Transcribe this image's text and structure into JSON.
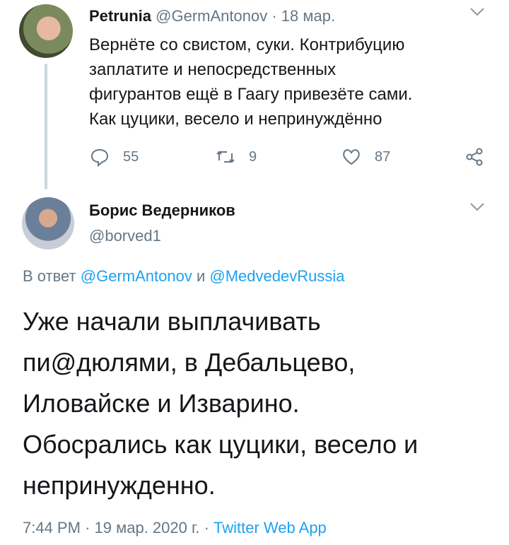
{
  "parent": {
    "author_name": "Petrunia",
    "handle": "@GermAntonov",
    "separator": "·",
    "date": "18 мар.",
    "text_lines": [
      "Вернёте со свистом, суки. Контрибуцию",
      "заплатите и непосредственных",
      "фигурантов ещё в Гаагу привезёте сами.",
      "Как цуцики, весело и непринуждённо"
    ],
    "replies": "55",
    "retweets": "9",
    "likes": "87",
    "icons": [
      "reply-icon",
      "retweet-icon",
      "like-icon",
      "share-icon",
      "chevron-down-icon"
    ]
  },
  "reply": {
    "author_name": "Борис Ведерников",
    "handle": "@borved1",
    "reply_prefix": "В ответ",
    "reply_to_1": "@GermAntonov",
    "reply_joiner": "и",
    "reply_to_2": "@MedvedevRussia",
    "text_lines": [
      "Уже начали выплачивать",
      "пи@дюлями, в Дебальцево,",
      "Иловайске и Изварино.",
      "Обосрались как цуцики, весело и",
      "непринужденно."
    ],
    "time": "7:44 PM",
    "separator": "·",
    "date": "19 мар. 2020 г.",
    "source": "Twitter Web App"
  },
  "colors": {
    "text": "#14171a",
    "muted": "#657786",
    "link": "#1da1f2",
    "thread_line": "#ccd6dd"
  }
}
